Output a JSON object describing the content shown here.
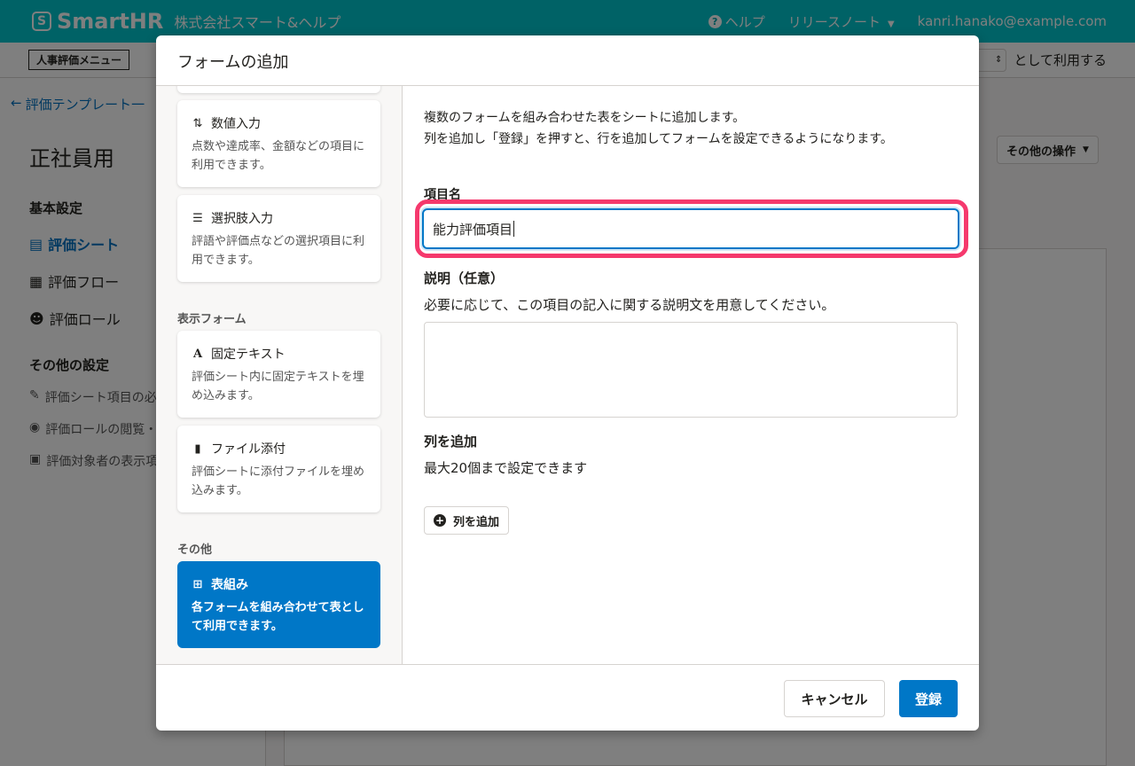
{
  "header": {
    "logo_mark": "S",
    "logo_text": "SmartHR",
    "company": "株式会社スマート&ヘルプ",
    "help": "ヘルプ",
    "release_notes": "リリースノート",
    "user_email": "kanri.hanako@example.com"
  },
  "subbar": {
    "menu_badge": "人事評価メニュー",
    "use_as": "として利用する"
  },
  "sidebar": {
    "back_link": "評価テンプレート一",
    "page_title": "正社員用",
    "basic_settings": "基本設定",
    "items": [
      {
        "label": "評価シート",
        "icon": "file-icon"
      },
      {
        "label": "評価フロー",
        "icon": "calendar-icon"
      },
      {
        "label": "評価ロール",
        "icon": "users-icon"
      }
    ],
    "other_settings": "その他の設定",
    "sub_items": [
      {
        "label": "評価シート項目の必",
        "icon": "pencil-icon"
      },
      {
        "label": "評価ロールの閲覧・",
        "icon": "eye-icon"
      },
      {
        "label": "評価対象者の表示項",
        "icon": "id-card-icon"
      }
    ]
  },
  "background": {
    "other_actions": "その他の操作"
  },
  "modal": {
    "title": "フォームの追加",
    "form_cards": [
      {
        "title": "数値入力",
        "desc": "点数や達成率、金額などの項目に利用できます。",
        "icon": "sort-numeric-icon"
      },
      {
        "title": "選択肢入力",
        "desc": "評語や評価点などの選択項目に利用できます。",
        "icon": "list-icon"
      }
    ],
    "display_group_label": "表示フォーム",
    "display_cards": [
      {
        "title": "固定テキスト",
        "desc": "評価シート内に固定テキストを埋め込みます。",
        "icon": "font-icon"
      },
      {
        "title": "ファイル添付",
        "desc": "評価シートに添付ファイルを埋め込みます。",
        "icon": "file-icon"
      }
    ],
    "other_group_label": "その他",
    "selected_card": {
      "title": "表組み",
      "desc": "各フォームを組み合わせて表として利用できます。",
      "icon": "table-icon"
    },
    "intro_line1": "複数のフォームを組み合わせた表をシートに追加します。",
    "intro_line2": "列を追加し「登録」を押すと、行を追加してフォームを設定できるようになります。",
    "name_label": "項目名",
    "name_value": "能力評価項目",
    "desc_label": "説明（任意）",
    "desc_help": "必要に応じて、この項目の記入に関する説明文を用意してください。",
    "desc_value": "",
    "cols_label": "列を追加",
    "cols_help": "最大20個まで設定できます",
    "add_col_button": "列を追加",
    "cancel_button": "キャンセル",
    "submit_button": "登録"
  },
  "colors": {
    "brand": "#00c4cc",
    "primary": "#0077c7",
    "highlight": "#f5396d"
  }
}
